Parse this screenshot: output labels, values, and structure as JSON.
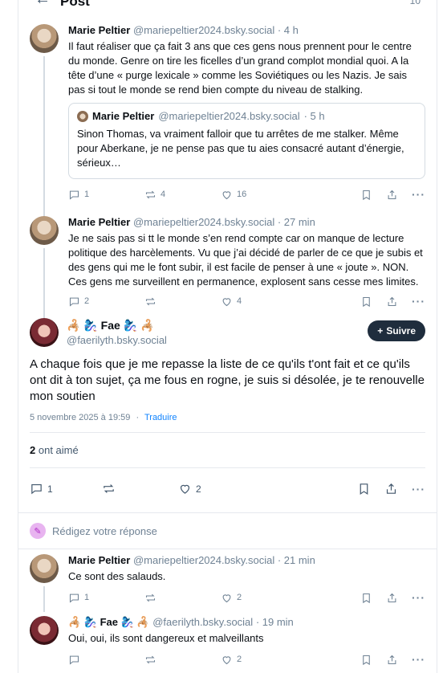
{
  "header": {
    "back": "←",
    "title": "Post",
    "count": "10"
  },
  "posts": [
    {
      "name": "Marie Peltier",
      "handle": "@mariepeltier2024.bsky.social",
      "time": "· 4 h",
      "text": "Il faut réaliser que ça fait 3 ans que ces gens nous prennent pour le centre du monde. Genre on tire les ficelles d’un grand complot mondial quoi. A la tête d’une « purge lexicale » comme les Soviétiques ou les Nazis. Je sais pas si tout le monde se rend bien compte du niveau de stalking.",
      "quote": {
        "name": "Marie Peltier",
        "handle": "@mariepeltier2024.bsky.social",
        "time": "· 5 h",
        "text": "Sinon Thomas, va vraiment falloir que tu arrêtes de me stalker. Même pour Aberkane, je ne pense pas que tu aies consacré autant d’énergie, sérieux…"
      },
      "replies": "1",
      "reposts": "4",
      "likes": "16"
    },
    {
      "name": "Marie Peltier",
      "handle": "@mariepeltier2024.bsky.social",
      "time": "· 27 min",
      "text": "Je ne sais pas si tt le monde s’en rend compte car on manque de lecture politique des harcèlements. Vu que j’ai décidé de parler de ce que je subis et des gens qui me le font subir, il est facile de penser à une « joute ». NON. Ces gens me surveillent en permanence, explosent sans cesse mes limites.",
      "replies": "2",
      "reposts": "",
      "likes": "4"
    }
  ],
  "main": {
    "display_name": "🦂 🧞‍♀️ Fae 🧞‍♀️ 🦂",
    "handle": "@faerilyth.bsky.social",
    "follow_label": "Suivre",
    "text": "A chaque fois que je me repasse la liste de ce qu'ils t'ont fait et ce qu'ils ont dit à ton sujet, ça me fous en rogne, je suis si désolée, je te renouvelle mon soutien",
    "date": "5 novembre 2025 à 19:59",
    "dot": "·",
    "translate": "Traduire",
    "likes_count": "2",
    "likes_label": "ont aimé",
    "replies": "1",
    "reposts": "",
    "likes": "2"
  },
  "composer": {
    "placeholder": "Rédigez votre réponse"
  },
  "replies": [
    {
      "name": "Marie Peltier",
      "handle": "@mariepeltier2024.bsky.social",
      "time": "· 21 min",
      "text": "Ce sont des salauds.",
      "replies": "1",
      "reposts": "",
      "likes": "2"
    },
    {
      "name": "🦂 🧞‍♀️ Fae 🧞‍♀️ 🦂",
      "handle": "@faerilyth.bsky.social",
      "time": "· 19 min",
      "text": "Oui, oui, ils sont dangereux et malveillants",
      "replies": "",
      "reposts": "",
      "likes": "2"
    }
  ],
  "icons": {
    "reply": "reply-icon",
    "repost": "repost-icon",
    "like": "heart-icon",
    "bookmark": "bookmark-icon",
    "share": "share-icon",
    "more": "more-icon"
  },
  "colors": {
    "accent": "#1083fe",
    "follow_bg": "#1f2d3d",
    "muted": "#6f8294"
  }
}
